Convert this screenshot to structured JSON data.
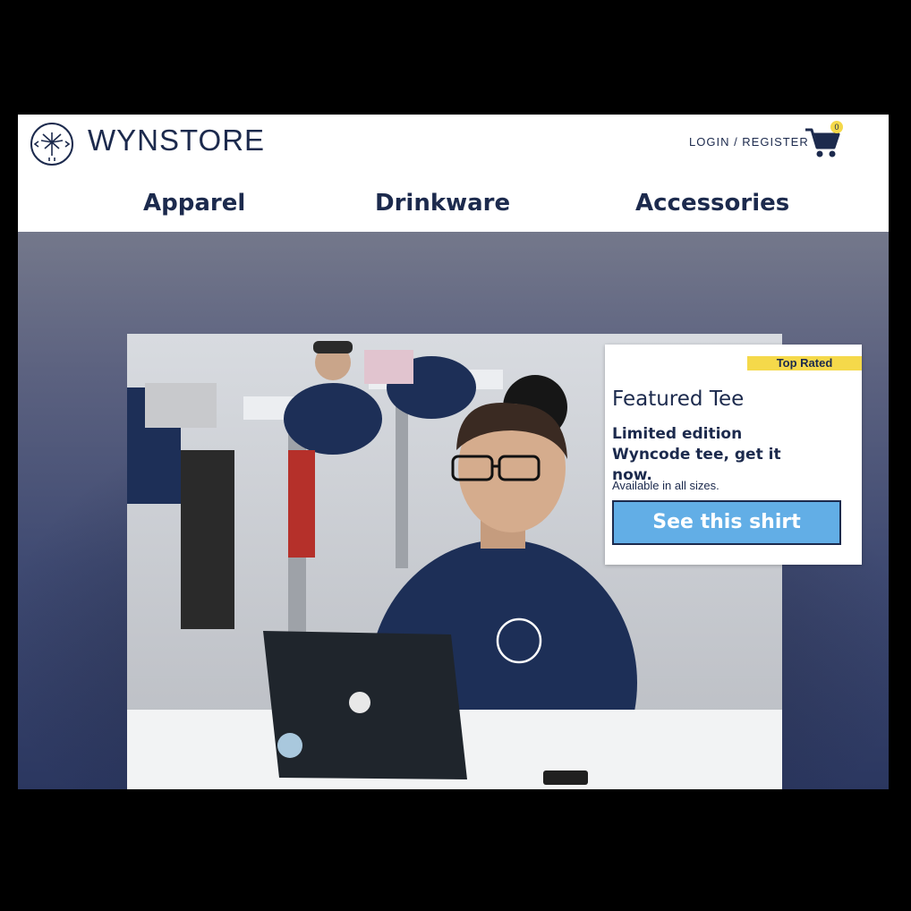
{
  "brand": {
    "name": "WYNSTORE",
    "logo_icon": "palm-compass-icon"
  },
  "header": {
    "login_label": "LOGIN / REGISTER",
    "cart_icon": "cart-icon",
    "cart_count": "0"
  },
  "nav": {
    "items": [
      {
        "label": "Apparel"
      },
      {
        "label": "Drinkware"
      },
      {
        "label": "Accessories"
      }
    ]
  },
  "hero": {
    "image_alt": ""
  },
  "featured": {
    "badge": "Top Rated",
    "title": "Featured Tee",
    "description": "Limited edition Wyncode tee, get it now.",
    "note": "Available in all sizes.",
    "cta_label": "See this shirt"
  },
  "colors": {
    "brand_navy": "#1c2a4d",
    "badge_yellow": "#f5d94a",
    "cta_blue": "#62aee6"
  }
}
